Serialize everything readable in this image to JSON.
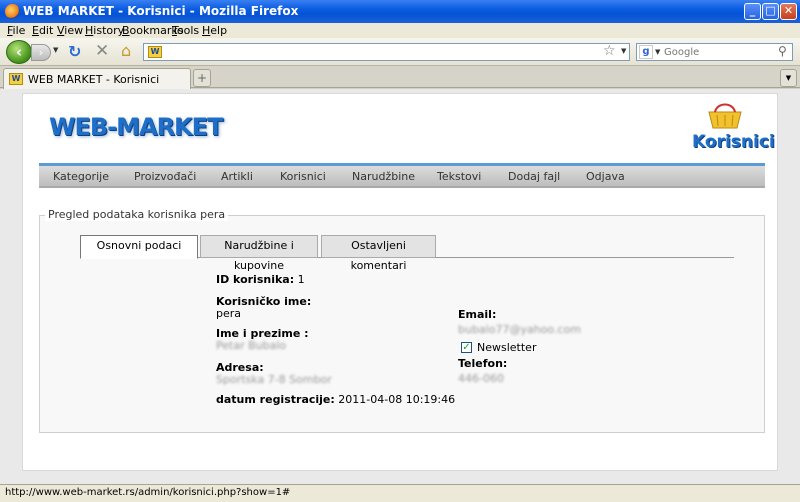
{
  "window": {
    "title": "WEB MARKET - Korisnici - Mozilla Firefox"
  },
  "menu": [
    "File",
    "Edit",
    "View",
    "History",
    "Bookmarks",
    "Tools",
    "Help"
  ],
  "toolbar": {
    "url": "",
    "search_placeholder": "Google"
  },
  "tab": {
    "title": "WEB MARKET - Korisnici",
    "new_tab": "+"
  },
  "page": {
    "logo": "WEB-MARKET",
    "section_title": "Korisnici",
    "nav": [
      "Kategorije",
      "Proizvođači",
      "Artikli",
      "Korisnici",
      "Narudžbine",
      "Tekstovi",
      "Dodaj fajl",
      "Odjava"
    ],
    "legend": "Pregled podataka korisnika pera",
    "subtabs": [
      "Osnovni podaci",
      "Narudžbine i kupovine",
      "Ostavljeni komentari"
    ],
    "user": {
      "id_label": "ID korisnika:",
      "id_value": "1",
      "username_label": "Korisničko ime:",
      "username_value": "pera",
      "fullname_label": "Ime i prezime :",
      "fullname_value": "Petar Bubalo",
      "address_label": "Adresa:",
      "address_value": "Sportska 7-8 Sombor",
      "registered_label": "datum registracije:",
      "registered_value": "2011-04-08 10:19:46",
      "email_label": "Email:",
      "email_value": "bubalo77@yahoo.com",
      "newsletter_label": "Newsletter",
      "newsletter_checked": true,
      "phone_label": "Telefon:",
      "phone_value": "446-060"
    }
  },
  "status": {
    "text": "http://www.web-market.rs/admin/korisnici.php?show=1#"
  }
}
